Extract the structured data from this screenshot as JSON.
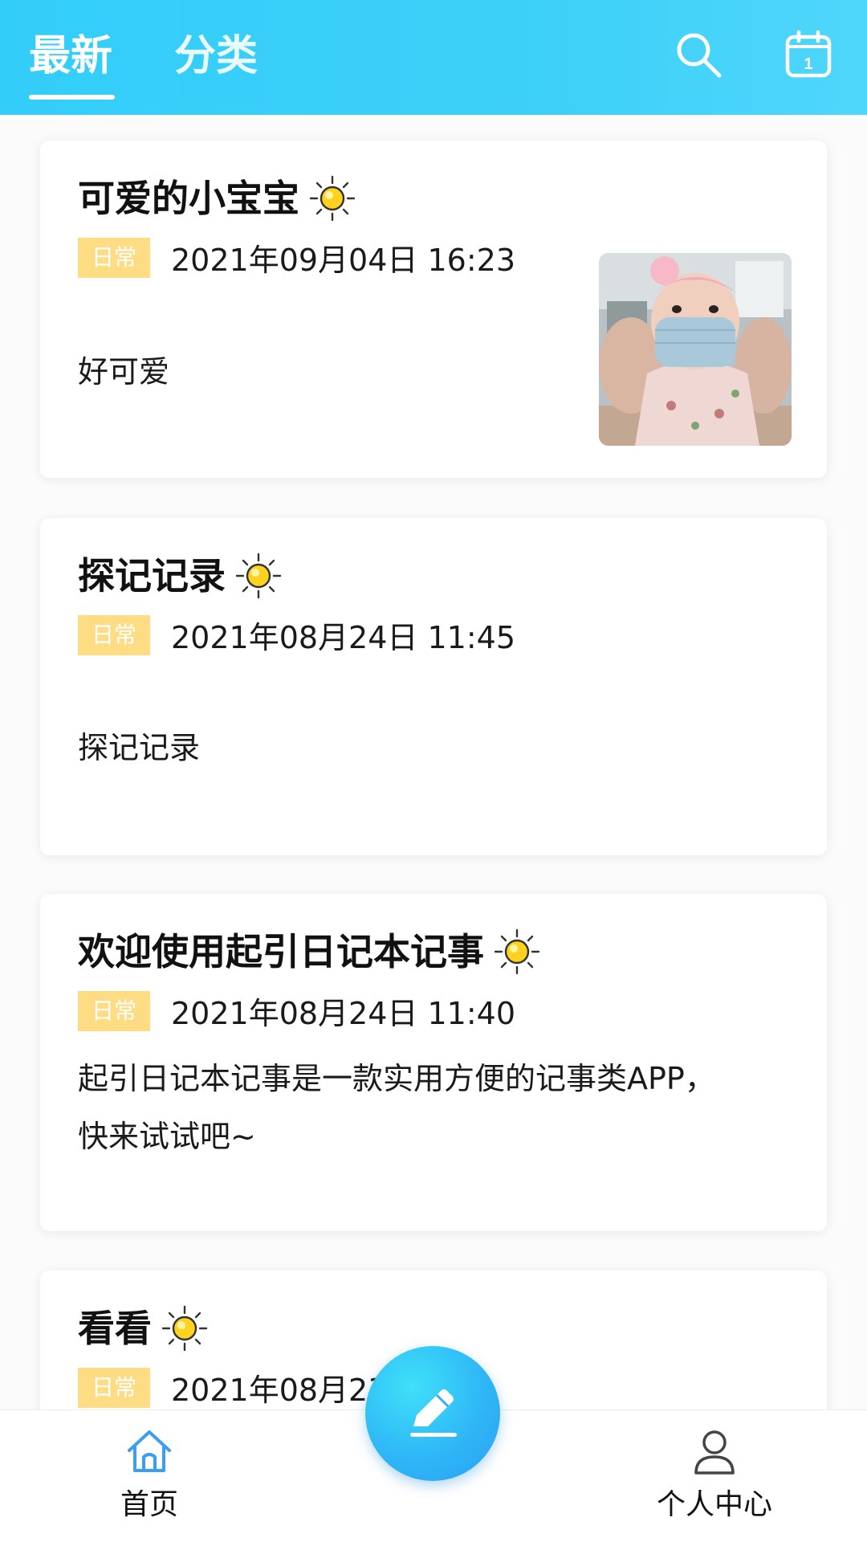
{
  "header": {
    "tabs": [
      {
        "label": "最新",
        "active": true
      },
      {
        "label": "分类",
        "active": false
      }
    ],
    "icons": [
      "search-icon",
      "calendar-icon"
    ],
    "calendar_day": "1",
    "colors": {
      "bar": "#33cdfa",
      "text": "#ffffff"
    }
  },
  "entries": [
    {
      "title": "可爱的小宝宝",
      "weather": "sun-icon",
      "tag": "日常",
      "date": "2021年09月04日 16:23",
      "body": "好可爱",
      "has_photo": true
    },
    {
      "title": "探记记录",
      "weather": "sun-icon",
      "tag": "日常",
      "date": "2021年08月24日 11:45",
      "body": "探记记录"
    },
    {
      "title": "欢迎使用起引日记本记事",
      "weather": "sun-icon",
      "tag": "日常",
      "date": "2021年08月24日 11:40",
      "body_line1": "起引日记本记事是一款实用方便的记事类APP，",
      "body_line2": "快来试试吧~"
    },
    {
      "title": "看看",
      "weather": "sun-icon",
      "tag": "日常",
      "date": "2021年08月23"
    }
  ],
  "bottom_nav": {
    "home_label": "首页",
    "profile_label": "个人中心",
    "fab_icon": "edit-pencil-icon",
    "colors": {
      "active": "#3b9ef0",
      "tag_bg": "#fddc83"
    }
  }
}
